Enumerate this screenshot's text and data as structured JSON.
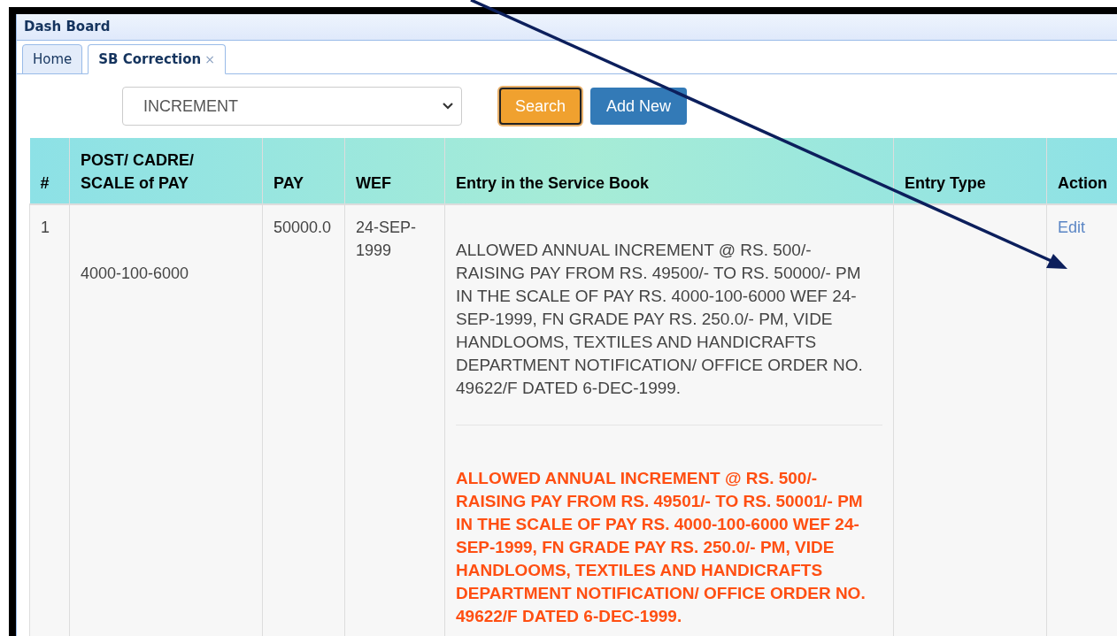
{
  "panel": {
    "title": "Dash Board"
  },
  "tabs": [
    {
      "label": "Home",
      "selected": false,
      "closable": false
    },
    {
      "label": "SB Correction",
      "selected": true,
      "closable": true,
      "close_label": "×"
    }
  ],
  "filter": {
    "value": "INCREMENT"
  },
  "buttons": [
    {
      "label": "Search",
      "kind": "search",
      "focused": true
    },
    {
      "label": "Add New",
      "kind": "add",
      "focused": false
    }
  ],
  "table": {
    "columns": [
      "#",
      "POST/ CADRE/ SCALE of PAY",
      "PAY",
      "WEF",
      "Entry in the Service Book",
      "Entry Type",
      "Action"
    ],
    "rows": [
      {
        "number": "1",
        "post": "4000-100-6000",
        "pay": "50000.0",
        "wef": "24-SEP-1999",
        "entries": [
          {
            "kind": "original",
            "text": "ALLOWED ANNUAL INCREMENT @ RS. 500/- RAISING PAY FROM RS. 49500/- TO RS. 50000/- PM IN THE SCALE OF PAY RS. 4000-100-6000 WEF 24-SEP-1999, FN GRADE PAY RS. 250.0/- PM, VIDE HANDLOOMS, TEXTILES AND HANDICRAFTS DEPARTMENT NOTIFICATION/ OFFICE ORDER NO. 49622/F DATED 6-DEC-1999."
          },
          {
            "kind": "corrected",
            "text": "ALLOWED ANNUAL INCREMENT @ RS. 500/- RAISING PAY FROM RS. 49501/- TO RS. 50001/- PM IN THE SCALE OF PAY RS. 4000-100-6000 WEF 24-SEP-1999, FN GRADE PAY RS. 250.0/- PM, VIDE HANDLOOMS, TEXTILES AND HANDICRAFTS DEPARTMENT NOTIFICATION/ OFFICE ORDER NO. 49622/F DATED 6-DEC-1999."
          }
        ],
        "action": "Edit"
      }
    ]
  },
  "annotation": {
    "kind": "arrow"
  }
}
